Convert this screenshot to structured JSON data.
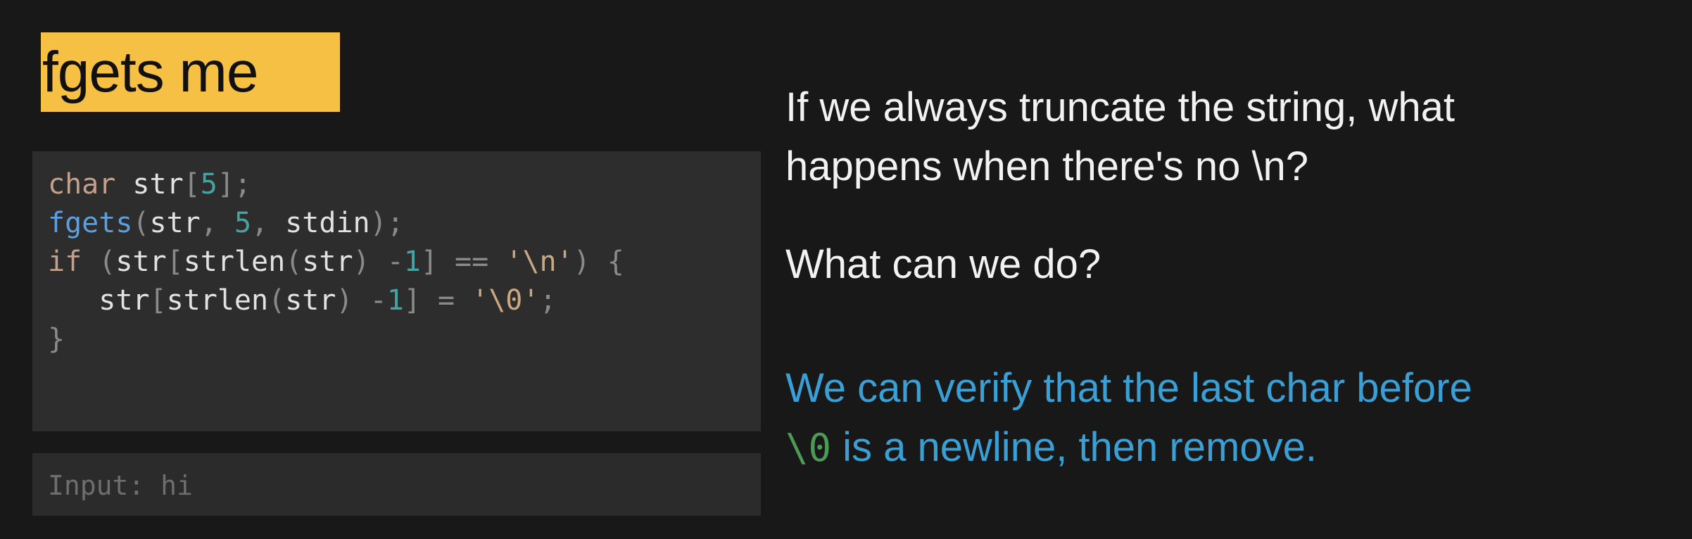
{
  "slide": {
    "title": "fgets me",
    "code_lines": [
      [
        {
          "t": "char",
          "c": "kw"
        },
        {
          "t": " str",
          "c": "id"
        },
        {
          "t": "[",
          "c": "punc"
        },
        {
          "t": "5",
          "c": "num"
        },
        {
          "t": "];",
          "c": "punc"
        }
      ],
      [
        {
          "t": "fgets",
          "c": "fn"
        },
        {
          "t": "(",
          "c": "punc"
        },
        {
          "t": "str",
          "c": "id"
        },
        {
          "t": ", ",
          "c": "punc"
        },
        {
          "t": "5",
          "c": "num"
        },
        {
          "t": ", ",
          "c": "punc"
        },
        {
          "t": "stdin",
          "c": "id"
        },
        {
          "t": ");",
          "c": "punc"
        }
      ],
      [
        {
          "t": "if",
          "c": "kw"
        },
        {
          "t": " (",
          "c": "punc"
        },
        {
          "t": "str",
          "c": "id"
        },
        {
          "t": "[",
          "c": "punc"
        },
        {
          "t": "strlen",
          "c": "id"
        },
        {
          "t": "(",
          "c": "punc"
        },
        {
          "t": "str",
          "c": "id"
        },
        {
          "t": ") -",
          "c": "punc"
        },
        {
          "t": "1",
          "c": "num"
        },
        {
          "t": "] == ",
          "c": "punc"
        },
        {
          "t": "'\\n'",
          "c": "str"
        },
        {
          "t": ") {",
          "c": "punc"
        }
      ],
      [
        {
          "t": "   str",
          "c": "id"
        },
        {
          "t": "[",
          "c": "punc"
        },
        {
          "t": "strlen",
          "c": "id"
        },
        {
          "t": "(",
          "c": "punc"
        },
        {
          "t": "str",
          "c": "id"
        },
        {
          "t": ") -",
          "c": "punc"
        },
        {
          "t": "1",
          "c": "num"
        },
        {
          "t": "] = ",
          "c": "punc"
        },
        {
          "t": "'\\0'",
          "c": "str"
        },
        {
          "t": ";",
          "c": "punc"
        }
      ],
      [
        {
          "t": "}",
          "c": "punc"
        }
      ]
    ],
    "input_label": "Input: hi",
    "question_line1": "If we always truncate the string, what",
    "question_line2": "happens when there's no \\n?",
    "question2": "What can we do?",
    "answer_line1": "We can verify that the last char before",
    "answer_code": "\\0",
    "answer_line2_rest": " is a newline, then remove."
  },
  "colors": {
    "kw": "#c4a088",
    "fn": "#5a9fe0",
    "num": "#45a3a3",
    "str": "#c9a882",
    "id": "#e2e2e2",
    "punc": "#8a8a8a",
    "highlight": "#f5c044",
    "answer": "#3a9fd5",
    "answer_code": "#4c9a55"
  }
}
